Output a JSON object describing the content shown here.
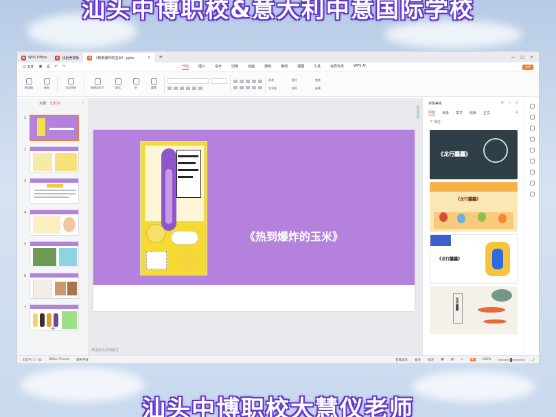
{
  "banner": {
    "top": "汕头中博职校&意大利中意国际学校",
    "bottom": "汕头中博职校大慧仪老师"
  },
  "window_tabs": [
    {
      "label": "WPS Office"
    },
    {
      "label": "找稻壳模板"
    },
    {
      "label": "《热到爆炸的玉米》.pptx"
    }
  ],
  "menu": {
    "file": "三 文件",
    "tabs": [
      "开始",
      "插入",
      "设计",
      "切换",
      "动画",
      "放映",
      "审阅",
      "视图",
      "工具",
      "会员专享",
      "WPS AI"
    ],
    "active_tab": "开始",
    "share": "分享"
  },
  "ribbon": {
    "groups": [
      "格式刷",
      "粘贴",
      "当页开始",
      "新建幻灯片",
      "版式",
      "节",
      "重置"
    ],
    "right_groups": [
      "形状",
      "图片",
      "查找",
      "文本框",
      "排列",
      "选择"
    ]
  },
  "left_pane": {
    "tabs": [
      "大纲",
      "幻灯片"
    ],
    "active_tab": "幻灯片",
    "slide_numbers": [
      "1",
      "2",
      "3",
      "4",
      "5",
      "6",
      "7"
    ],
    "add_slide": "+"
  },
  "slide": {
    "title": "《热到爆炸的玉米》",
    "notes_placeholder": "单击此处添加备注"
  },
  "right_pane": {
    "header": "对象美化",
    "tabs": [
      "封面",
      "目录",
      "章节",
      "结束",
      "正文"
    ],
    "active_tab": "封面",
    "filter": "筛选",
    "templates": [
      {
        "label": "《龙行龘龘》"
      },
      {
        "label": "《龙行龘龘》"
      },
      {
        "label": "《龙行龘龘》"
      },
      {
        "label": "《龙行龘龘》"
      }
    ]
  },
  "status": {
    "slide_pos": "幻灯片 1 / 32",
    "theme": "Office Theme",
    "missing_font": "缺失字体",
    "smart_beautify": "智能美化",
    "notes": "备注",
    "comments": "批注",
    "zoom": "100%"
  },
  "colors": {
    "slide_purple": "#b482dc",
    "accent_orange": "#f07a3a",
    "active_red": "#d94b2a"
  }
}
